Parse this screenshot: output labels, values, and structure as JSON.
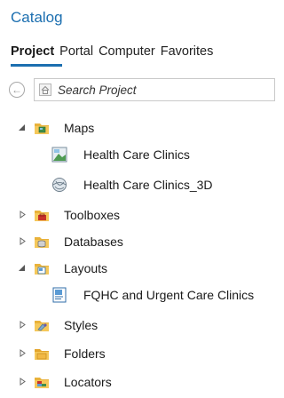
{
  "catalog": {
    "title": "Catalog",
    "tabs": [
      {
        "label": "Project",
        "active": true
      },
      {
        "label": "Portal",
        "active": false
      },
      {
        "label": "Computer",
        "active": false
      },
      {
        "label": "Favorites",
        "active": false
      }
    ],
    "search": {
      "placeholder": "Search Project",
      "value": ""
    },
    "accent_color": "#1c6fb0"
  },
  "tree": [
    {
      "label": "Maps",
      "icon": "maps-folder-icon",
      "expanded": true,
      "level": 0
    },
    {
      "label": "Health Care Clinics",
      "icon": "map-icon",
      "level": 1
    },
    {
      "label": "Health Care Clinics_3D",
      "icon": "globe-scene-icon",
      "level": 1
    },
    {
      "label": "Toolboxes",
      "icon": "toolboxes-folder-icon",
      "expanded": false,
      "level": 0
    },
    {
      "label": "Databases",
      "icon": "databases-folder-icon",
      "expanded": false,
      "level": 0
    },
    {
      "label": "Layouts",
      "icon": "layouts-folder-icon",
      "expanded": true,
      "level": 0
    },
    {
      "label": "FQHC and Urgent Care Clinics",
      "icon": "layout-icon",
      "level": 1
    },
    {
      "label": "Styles",
      "icon": "styles-folder-icon",
      "expanded": false,
      "level": 0
    },
    {
      "label": "Folders",
      "icon": "folders-folder-icon",
      "expanded": false,
      "level": 0
    },
    {
      "label": "Locators",
      "icon": "locators-folder-icon",
      "expanded": false,
      "level": 0
    }
  ]
}
